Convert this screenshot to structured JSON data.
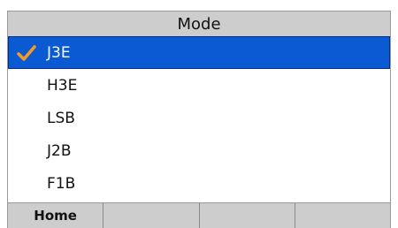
{
  "header": {
    "title": "Mode"
  },
  "mode_list": {
    "items": [
      {
        "label": "J3E",
        "selected": true
      },
      {
        "label": "H3E",
        "selected": false
      },
      {
        "label": "LSB",
        "selected": false
      },
      {
        "label": "J2B",
        "selected": false
      },
      {
        "label": "F1B",
        "selected": false
      }
    ],
    "check_icon": "checkmark-icon",
    "selected_color": "#0a5bd3",
    "check_color": "#f59a23"
  },
  "softkeys": {
    "keys": [
      {
        "label": "Home"
      },
      {
        "label": ""
      },
      {
        "label": ""
      },
      {
        "label": ""
      }
    ]
  }
}
